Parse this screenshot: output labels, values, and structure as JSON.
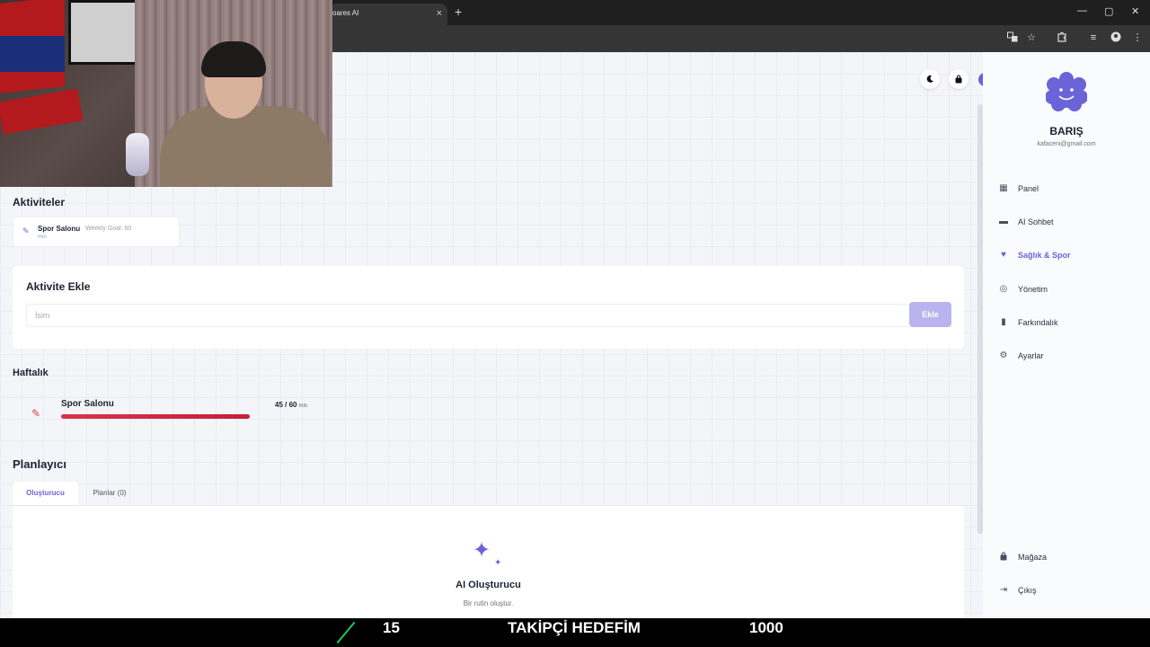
{
  "browser": {
    "tab_title": "oares AI",
    "tab_close": "×",
    "new_tab": "+",
    "window_controls": [
      "—",
      "▢",
      "✕"
    ],
    "toolbar_icons": [
      "translate-icon",
      "star-icon",
      "extensions-icon",
      "media-icon",
      "profile-icon",
      "menu-icon"
    ]
  },
  "header": {
    "icons": [
      "moon-icon",
      "bag-icon"
    ],
    "collapse_label": "›"
  },
  "activities": {
    "title": "Aktiviteler",
    "items": [
      {
        "name": "Spor Salonu",
        "goal_line1": "Weekly Goal: 60",
        "goal_line2": "min"
      }
    ]
  },
  "add_activity": {
    "title": "Aktivite Ekle",
    "input_placeholder": "İsim",
    "input_value": "",
    "button_label": "Ekle"
  },
  "weekly": {
    "title": "Haftalık",
    "items": [
      {
        "name": "Spor Salonu",
        "count": "45 / 60",
        "unit": "min",
        "progress": 0.75
      }
    ]
  },
  "planner": {
    "title": "Planlayıcı",
    "tabs": [
      {
        "label": "Oluşturucu",
        "active": true
      },
      {
        "label": "Planlar (0)",
        "active": false
      }
    ],
    "empty_title": "AI Oluşturucu",
    "empty_subtitle": "Bir rutin oluştur."
  },
  "sidebar": {
    "user_name": "BARIŞ",
    "user_email": "kafaceni@gmail.com",
    "items": [
      {
        "label": "Panel",
        "icon": "grid-icon",
        "active": false
      },
      {
        "label": "AI Sohbet",
        "icon": "chat-icon",
        "active": false
      },
      {
        "label": "Sağlık & Spor",
        "icon": "heart-icon",
        "active": true
      },
      {
        "label": "Yönetim",
        "icon": "target-icon",
        "active": false
      },
      {
        "label": "Farkındalık",
        "icon": "document-icon",
        "active": false
      },
      {
        "label": "Ayarlar",
        "icon": "gear-icon",
        "active": false
      }
    ],
    "bottom_items": [
      {
        "label": "Mağaza",
        "icon": "shopping-bag-icon"
      },
      {
        "label": "Çıkış",
        "icon": "logout-icon"
      }
    ]
  },
  "stream_overlay": {
    "follower_count": "15",
    "goal_label": "TAKİPÇİ HEDEFİM",
    "goal_value": "1000"
  },
  "colors": {
    "accent": "#6b63d8",
    "progress": "#d9334b",
    "button_disabled": "#b9b4ef"
  }
}
